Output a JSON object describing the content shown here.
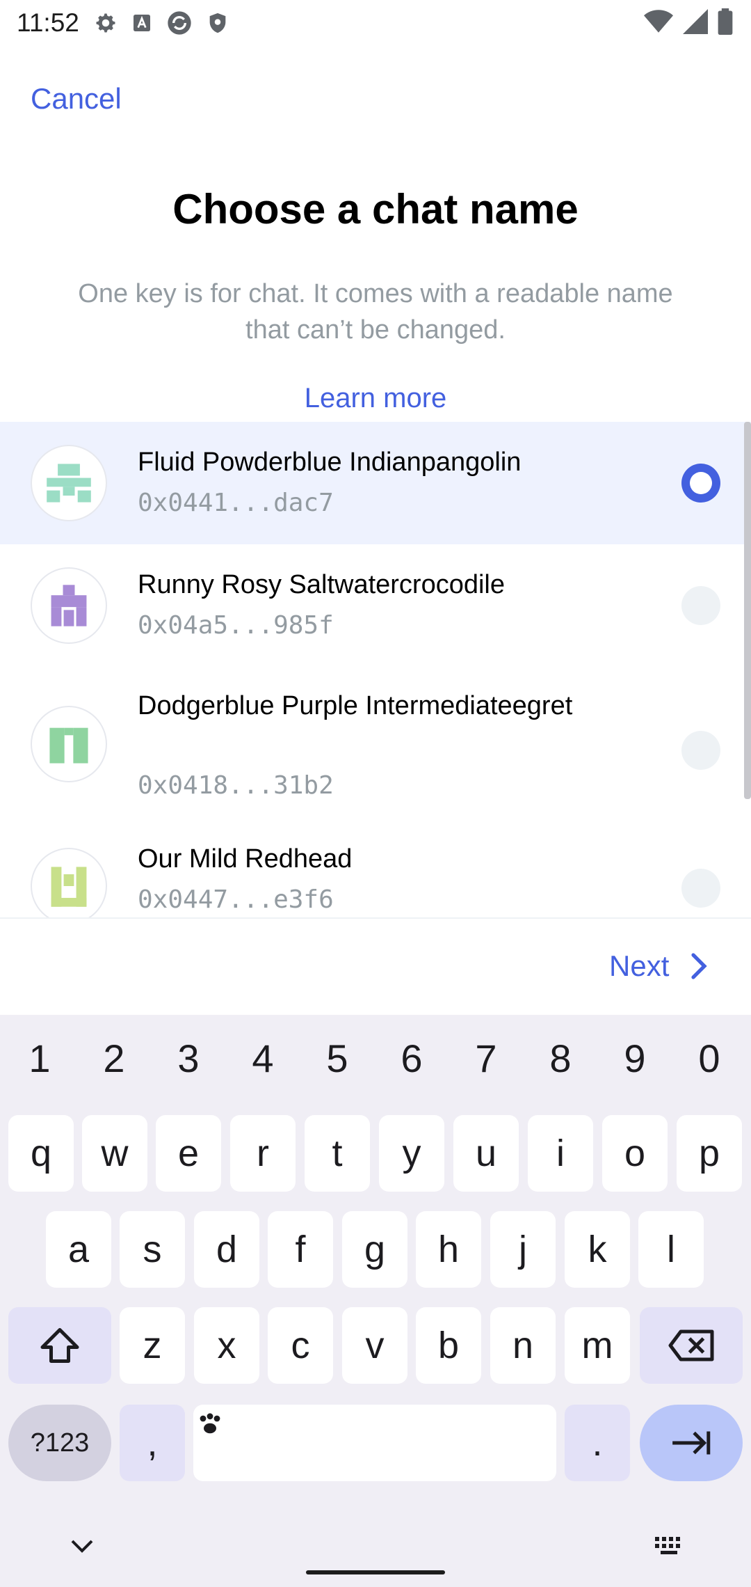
{
  "status_bar": {
    "time": "11:52",
    "icons_left": [
      "gear-icon",
      "a-box-icon",
      "sync-icon",
      "shield-icon"
    ],
    "icons_right": [
      "wifi-icon",
      "signal-icon",
      "battery-icon"
    ]
  },
  "header": {
    "cancel_label": "Cancel",
    "title": "Choose a chat name",
    "subtitle": "One key is for chat. It comes with a readable name that can’t be changed.",
    "learn_more_label": "Learn more"
  },
  "names": [
    {
      "name": "Fluid Powderblue Indianpangolin",
      "key": "0x0441...dac7",
      "selected": true,
      "avatar_color": "#9bddc5"
    },
    {
      "name": "Runny Rosy Saltwatercrocodile",
      "key": "0x04a5...985f",
      "selected": false,
      "avatar_color": "#a88bd6"
    },
    {
      "name": "Dodgerblue Purple Intermediateegret",
      "key": "0x0418...31b2",
      "selected": false,
      "avatar_color": "#8fd4a0"
    },
    {
      "name": "Our Mild Redhead",
      "key": "0x0447...e3f6",
      "selected": false,
      "avatar_color": "#c8e08a"
    }
  ],
  "footer": {
    "next_label": "Next"
  },
  "keyboard": {
    "numbers": [
      "1",
      "2",
      "3",
      "4",
      "5",
      "6",
      "7",
      "8",
      "9",
      "0"
    ],
    "row1": [
      "q",
      "w",
      "e",
      "r",
      "t",
      "y",
      "u",
      "i",
      "o",
      "p"
    ],
    "row2": [
      "a",
      "s",
      "d",
      "f",
      "g",
      "h",
      "j",
      "k",
      "l"
    ],
    "row3": [
      "z",
      "x",
      "c",
      "v",
      "b",
      "n",
      "m"
    ],
    "symbols_label": "?123",
    "comma_label": ",",
    "period_label": "."
  },
  "colors": {
    "accent": "#4360df",
    "muted": "#939ba1",
    "selected_bg": "#eef2fe"
  }
}
